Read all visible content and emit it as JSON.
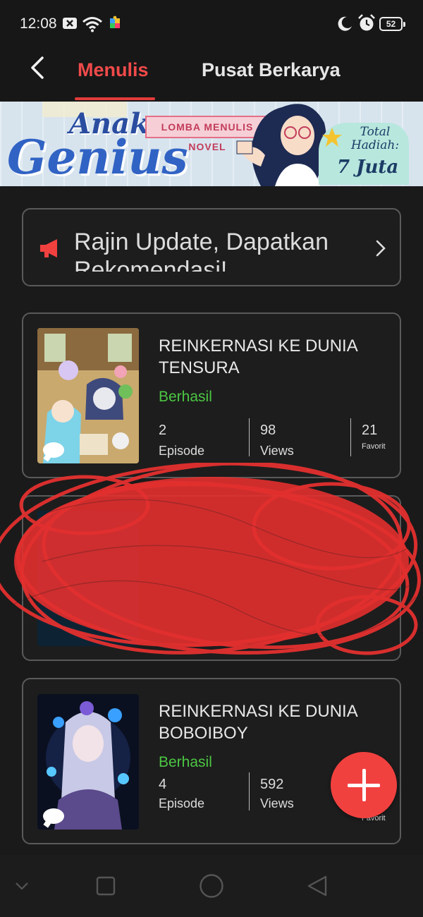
{
  "status_bar": {
    "time": "12:08",
    "battery": "52",
    "icons": [
      "notification-icon",
      "wifi-icon",
      "app-icon",
      "moon-icon",
      "alarm-icon",
      "battery-icon"
    ]
  },
  "header": {
    "tabs": [
      {
        "label": "Menulis",
        "active": true
      },
      {
        "label": "Pusat Berkarya",
        "active": false
      }
    ],
    "accent_color": "#f04a4a"
  },
  "banner": {
    "title_line1": "Anak",
    "title_line2": "Genius",
    "ribbon": "LOMBA MENULIS NOVEL",
    "prize_label": "Total Hadiah:",
    "prize_value": "7 Juta"
  },
  "notice": {
    "text": "Rajin Update, Dapatkan Rekomendasi!"
  },
  "works": [
    {
      "title": "REINKERNASI KE DUNIA TENSURA",
      "status": "Berhasil",
      "episodes": "2",
      "episodes_label": "Episode",
      "views": "98",
      "views_label": "Views",
      "favorites": "21",
      "favorites_label": "Favorit"
    },
    {
      "title": "REINKERNASI KE DUNIA BOBOIBOY",
      "status": "Berhasil",
      "episodes": "4",
      "episodes_label": "Episode",
      "views": "592",
      "views_label": "Views",
      "favorites_label": "Favorit"
    }
  ],
  "status_color": "#4cc743"
}
